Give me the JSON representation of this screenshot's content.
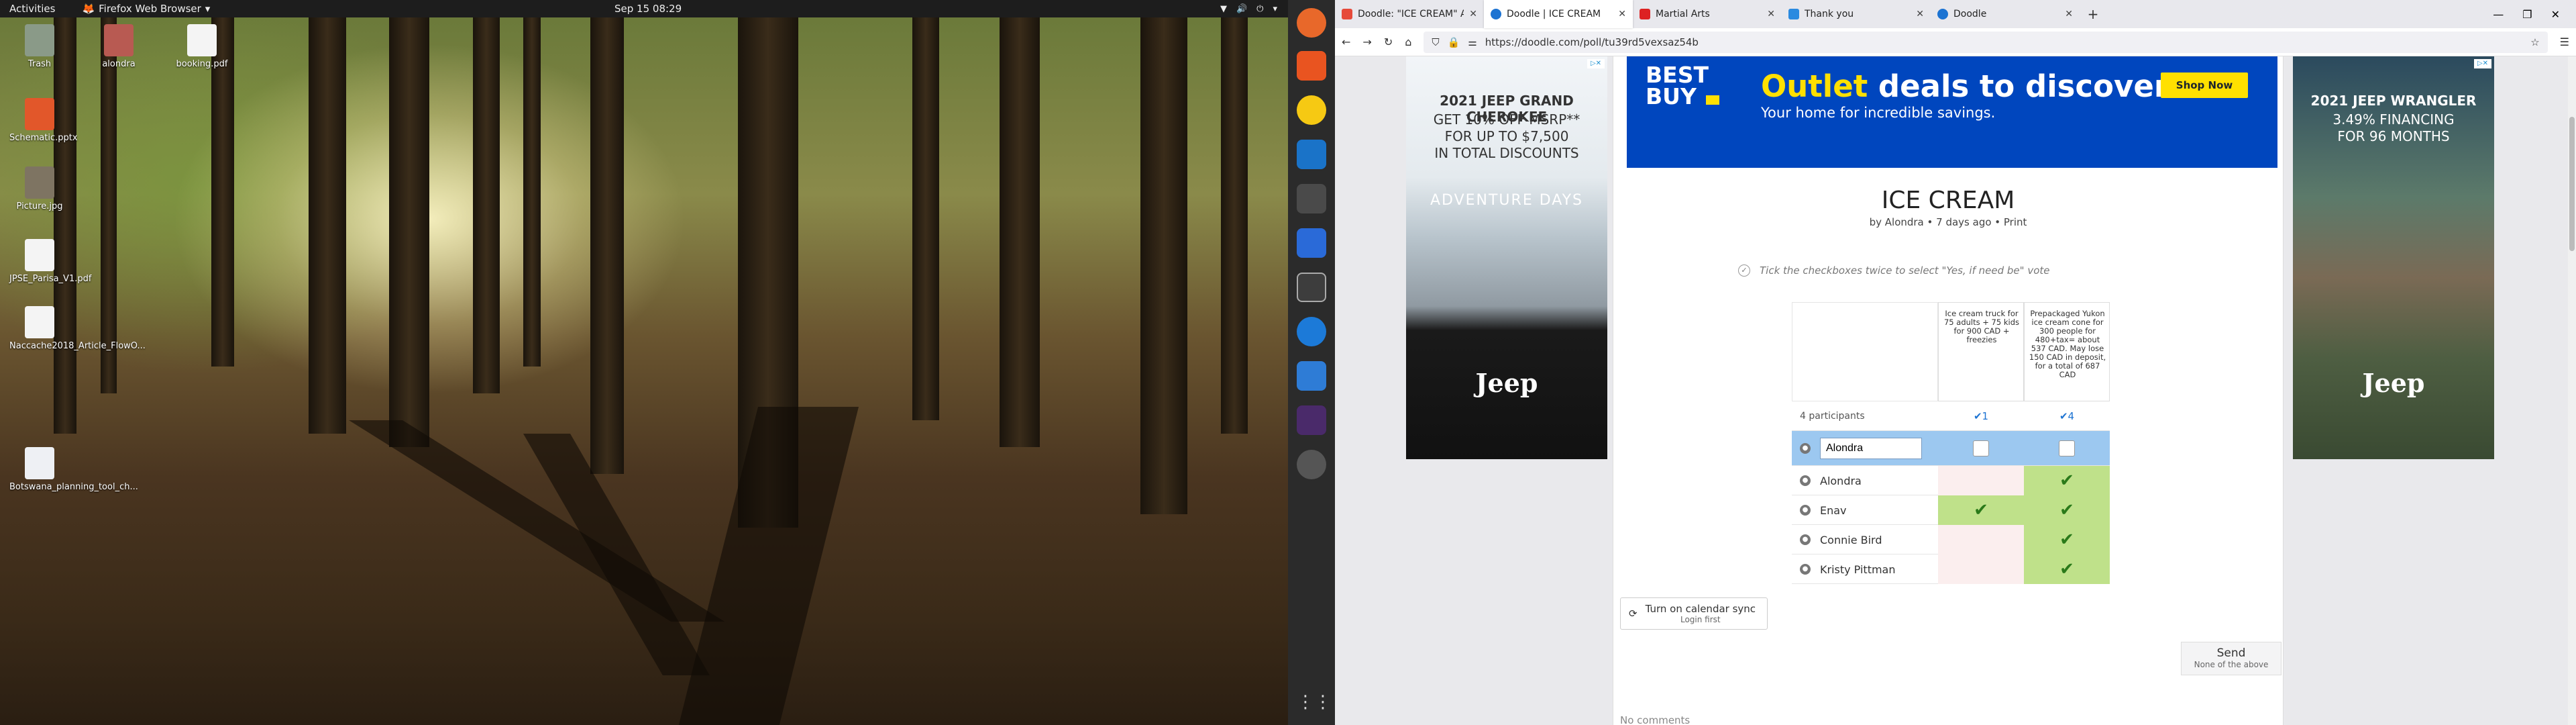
{
  "topbar": {
    "activities": "Activities",
    "app": "Firefox Web Browser",
    "clock": "Sep 15  08:29"
  },
  "desktop": {
    "icons": [
      {
        "label": "Trash"
      },
      {
        "label": "alondra"
      },
      {
        "label": "booking.pdf"
      },
      {
        "label": "Schematic.pptx"
      },
      {
        "label": "Picture.jpg"
      },
      {
        "label": "JPSE_Parisa_V1.pdf"
      },
      {
        "label": "Naccache2018_Article_FlowO..."
      },
      {
        "label": "Botswana_planning_tool_ch..."
      }
    ]
  },
  "tabs": [
    {
      "title": "Doodle: \"ICE CREAM\" Ad"
    },
    {
      "title": "Doodle | ICE CREAM"
    },
    {
      "title": "Martial Arts"
    },
    {
      "title": "Thank you"
    },
    {
      "title": "Doodle"
    }
  ],
  "address": {
    "url": "https://doodle.com/poll/tu39rd5vexsaz54b"
  },
  "ads": {
    "left": {
      "headline": "2021 JEEP GRAND CHEROKEE",
      "line1": "GET 10% OFF MSRP**",
      "line2": "FOR UP TO $7,500",
      "line3": "IN TOTAL DISCOUNTS",
      "event": "ADVENTURE DAYS",
      "brand": "Jeep"
    },
    "top": {
      "logo": "BEST BUY",
      "headline_yellow": "Outlet",
      "headline_white": " deals to discover.",
      "sub": "Your home for incredible savings.",
      "cta": "Shop Now"
    },
    "right": {
      "headline": "2021 JEEP WRANGLER",
      "line1": "3.49% FINANCING",
      "line2": "FOR 96 MONTHS",
      "brand": "Jeep"
    }
  },
  "poll": {
    "title": "ICE CREAM",
    "meta": "by Alondra • 7 days ago • Print",
    "hint": "Tick the checkboxes twice to select \"Yes, if need be\" vote",
    "options": [
      {
        "label": "Ice cream truck for 75 adults + 75 kids for 900 CAD + freezies",
        "count": "1"
      },
      {
        "label": "Prepackaged Yukon ice cream cone for 300 people for 480+tax= about 537 CAD. May lose 150 CAD in deposit, for a total of 687 CAD",
        "count": "4"
      }
    ],
    "participants_label": "4 participants",
    "input_value": "Alondra",
    "rows": [
      {
        "name": "Alondra",
        "votes": [
          "no",
          "yes"
        ]
      },
      {
        "name": "Enav",
        "votes": [
          "yes",
          "yes"
        ]
      },
      {
        "name": "Connie Bird",
        "votes": [
          "no",
          "yes"
        ]
      },
      {
        "name": "Kristy Pittman",
        "votes": [
          "no",
          "yes"
        ]
      }
    ],
    "calendar_btn": "Turn on calendar sync",
    "calendar_sub": "Login first",
    "send_btn": "Send",
    "send_sub": "None of the above",
    "no_comments": "No comments"
  },
  "colors": {
    "yes": "#bfe18a",
    "no": "#fbeeee",
    "selected_row": "#9cc8f0",
    "bestbuy_blue": "#0046be",
    "bestbuy_yellow": "#ffe000"
  }
}
